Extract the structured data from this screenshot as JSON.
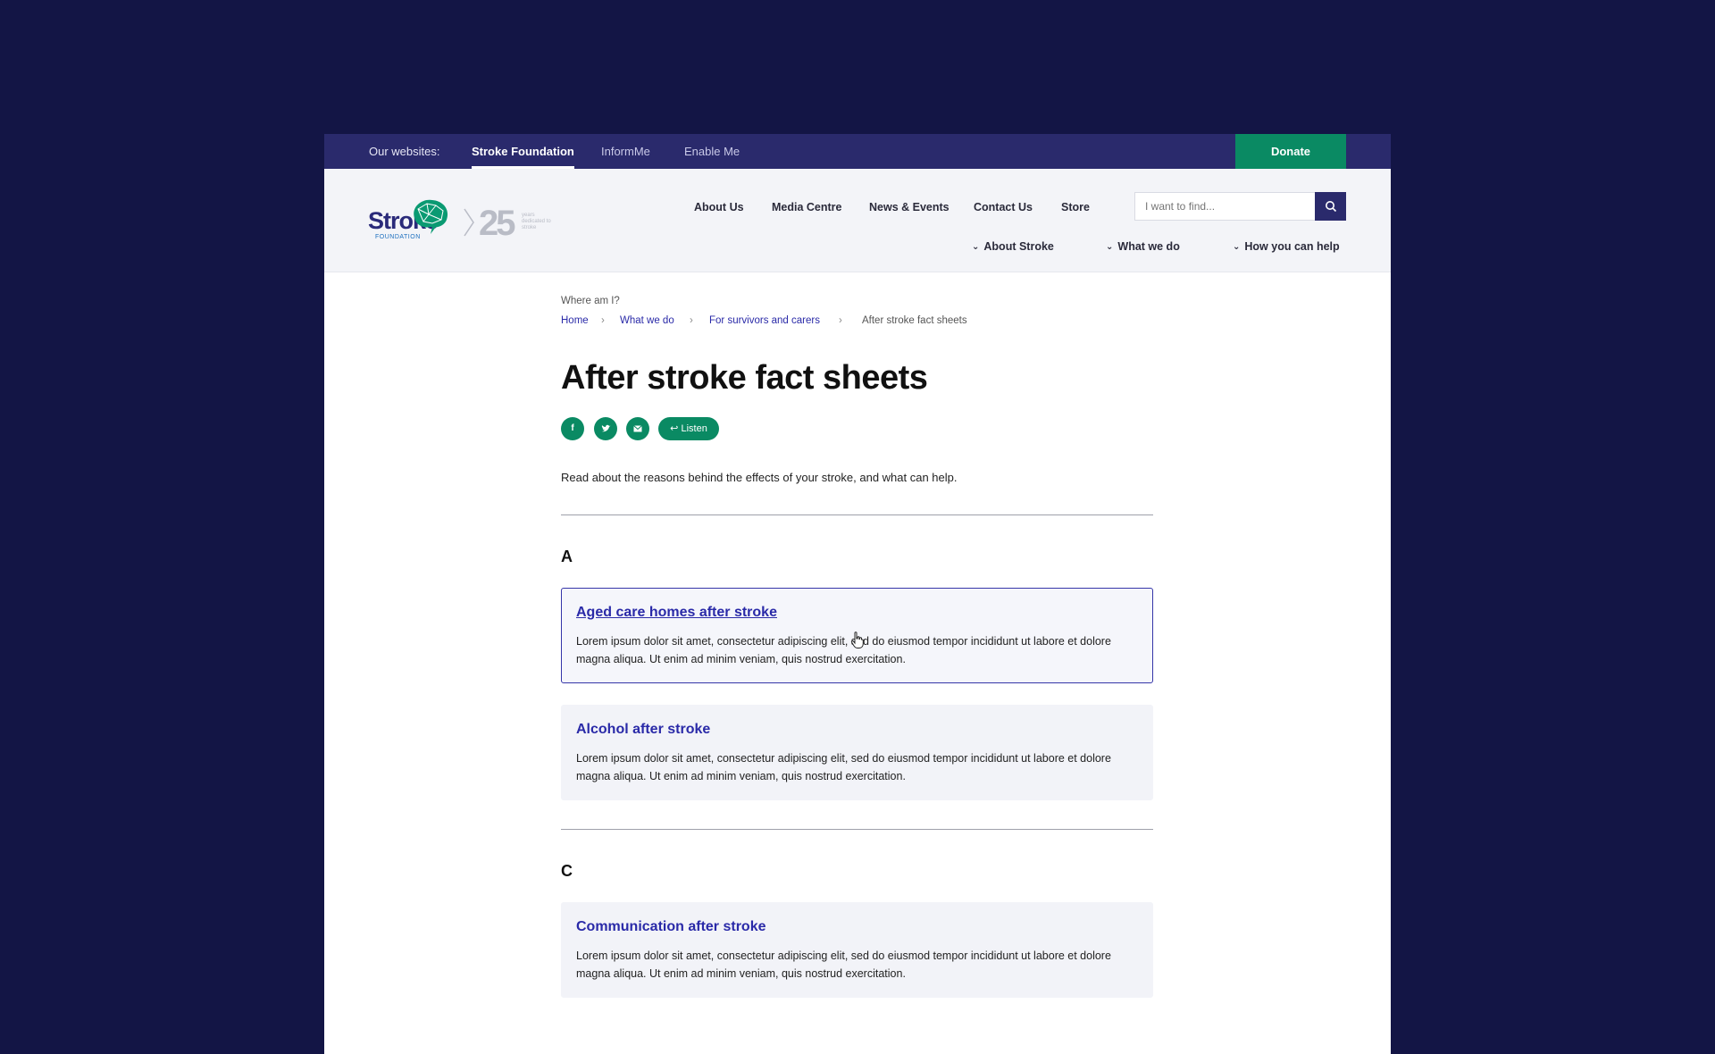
{
  "utility": {
    "label": "Our websites:",
    "sites": [
      "Stroke Foundation",
      "InformMe",
      "Enable Me"
    ],
    "donate": "Donate"
  },
  "logo": {
    "word": "Stroke",
    "sub": "FOUNDATION",
    "years": "25",
    "years_sub": "years dedicated to stroke"
  },
  "nav": {
    "main": [
      "About Us",
      "Media Centre",
      "News & Events",
      "Contact Us",
      "Store"
    ],
    "sub": [
      "About Stroke",
      "What we do",
      "How you can help"
    ]
  },
  "search": {
    "placeholder": "I want to find..."
  },
  "breadcrumb": {
    "label": "Where am I?",
    "items": [
      "Home",
      "What we do",
      "For survivors and carers"
    ],
    "current": "After stroke fact sheets"
  },
  "page": {
    "title": "After stroke fact sheets",
    "listen": "Listen",
    "intro": "Read about the reasons behind the effects of your stroke, and what can help."
  },
  "sections": [
    {
      "letter": "A",
      "items": [
        {
          "title": "Aged care homes after stroke",
          "desc": "Lorem ipsum dolor sit amet, consectetur adipiscing elit, sed do eiusmod tempor incididunt ut labore et dolore magna aliqua. Ut enim ad minim veniam, quis nostrud exercitation."
        },
        {
          "title": "Alcohol after stroke",
          "desc": "Lorem ipsum dolor sit amet, consectetur adipiscing elit, sed do eiusmod tempor incididunt ut labore et dolore magna aliqua. Ut enim ad minim veniam, quis nostrud exercitation."
        }
      ]
    },
    {
      "letter": "C",
      "items": [
        {
          "title": "Communication after stroke",
          "desc": "Lorem ipsum dolor sit amet, consectetur adipiscing elit, sed do eiusmod tempor incididunt ut labore et dolore magna aliqua. Ut enim ad minim veniam, quis nostrud exercitation."
        }
      ]
    }
  ],
  "colors": {
    "backdrop": "#131545",
    "utility_bar": "#2a2a6c",
    "accent_green": "#0a8a63",
    "link_blue": "#2a2aa8"
  },
  "icons": [
    "search-icon",
    "facebook-icon",
    "twitter-icon",
    "email-icon",
    "listen-icon",
    "chevron-down-icon",
    "chevron-right-icon",
    "hand-cursor-icon"
  ]
}
